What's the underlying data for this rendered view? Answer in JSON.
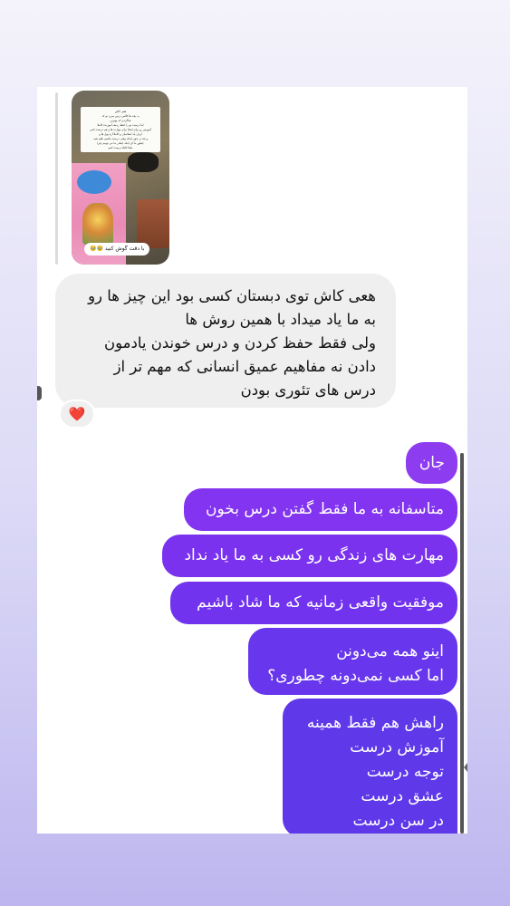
{
  "story_reply": {
    "card_lines": [
      "هعی کاش",
      "یه بچه ها کلاس درس میرن تو که",
      "شاگردی که بهترین",
      "اما درست تو را حفظ ردیف آموزنده کاملا",
      "آموزش رو برای اینجا برای مهارت ها و هم درست کمی",
      "ایران یاد اسلامیان و کاملا آره پول ها و",
      "و بعد در چون اینکه وقتی درست باشیم باهم همه",
      "چطور ما ای اینکه اینقدر ما می تونیم چیزا",
      "ماها کاملا درست کنیم"
    ],
    "sticker_label": "با دقت گوش کنید 🥹🥹"
  },
  "incoming_message": {
    "lines": [
      "هعی کاش توی دبستان کسی بود این چیز ها رو",
      "به ما یاد میداد با همین روش ها",
      "ولی فقط حفظ کردن و درس خوندن یادمون",
      "دادن نه مفاهیم عمیق انسانی که مهم تر از",
      "درس های تئوری بودن"
    ],
    "reaction": "❤️"
  },
  "outgoing_messages": {
    "m1": "جان",
    "m2": "متاسفانه به ما فقط گفتن درس بخون",
    "m3": "مهارت های زندگی رو کسی به ما یاد نداد",
    "m4": "موفقیت واقعی زمانیه که ما شاد باشیم",
    "m5": [
      "اینو همه می‌دونن",
      "اما کسی نمی‌دونه چطوری؟"
    ],
    "m6": [
      "راهش هم فقط همینه",
      "آموزش درست",
      "توجه درست",
      "عشق درست",
      "در سن درست"
    ]
  },
  "colors": {
    "bubble_gradient_top": "#8d3cf0",
    "bubble_gradient_bottom": "#5e38e9",
    "incoming_bubble": "#efefef",
    "page_background_bottom": "#bdb6ef"
  }
}
